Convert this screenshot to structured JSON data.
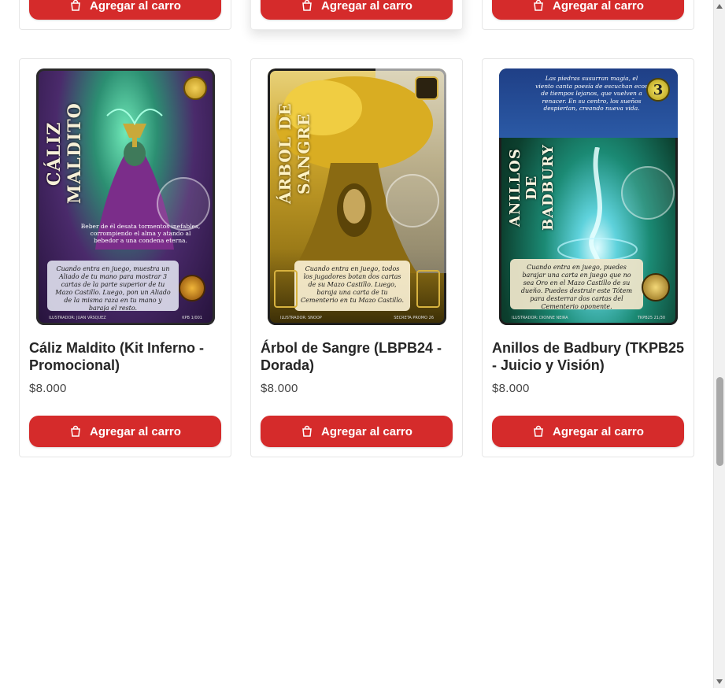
{
  "top_row": [
    {
      "button_label": "Agregar al carro"
    },
    {
      "button_label": "Agregar al carro"
    },
    {
      "button_label": "Agregar al carro"
    }
  ],
  "products": [
    {
      "title": "Cáliz Maldito (Kit Inferno - Promocional)",
      "price": "$8.000",
      "button_label": "Agregar al carro",
      "art_title": "CÁLIZ MALDITO",
      "art_flavor": "Beber de él desata tormentos inefables, corrompiendo el alma y atando al bebedor a una condena eterna.",
      "art_text": "Cuando entra en juego, muestra un Aliado de tu mano para mostrar 3 cartas de la parte superior de tu Mazo Castillo. Luego, pon un Aliado de la misma raza en tu mano y baraja el resto.",
      "art_illustrator": "ILUSTRADOR: JUAN VÁSQUEZ",
      "art_code": "KPB 1/001",
      "colors": {
        "bg1": "#3b1a52",
        "bg2": "#1f8a6b",
        "accent": "#d9b92a"
      }
    },
    {
      "title": "Árbol de Sangre (LBPB24 - Dorada)",
      "price": "$8.000",
      "button_label": "Agregar al carro",
      "art_title": "ÁRBOL DE SANGRE",
      "art_text": "Cuando entra en juego, todos los jugadores botan dos cartas de su Mazo Castillo. Luego, baraja una carta de tu Cementerio en tu Mazo Castillo.",
      "art_illustrator": "ILUSTRADOR: SNOOP",
      "art_code": "SECRETA PROMO 26",
      "colors": {
        "bg1": "#8a6a12",
        "bg2": "#e0b528",
        "accent": "#caa33a"
      }
    },
    {
      "title": "Anillos de Badbury (TKPB25 - Juicio y Visión)",
      "price": "$8.000",
      "button_label": "Agregar al carro",
      "art_title": "ANILLOS DE BADBURY",
      "art_flavor": "Las piedras susurran magia, el viento canta poesía de escuchan ecos de tiempos lejanos, que vuelven a renacer. En su centro, los sueños despiertan, creando nueva vida.",
      "art_text": "Cuando entra en juego, puedes barajar una carta en juego que no sea Oro en el Mazo Castillo de su dueño. Puedes destruir este Tótem para desterrar dos cartas del Cementerio oponente.",
      "art_illustrator": "ILUSTRADOR: DIONNE NEIRA",
      "art_code": "TKPB25 21/30",
      "art_cost": "3",
      "colors": {
        "bg1": "#0d5a3a",
        "bg2": "#2ab7c9",
        "accent": "#d8c74a"
      }
    }
  ]
}
